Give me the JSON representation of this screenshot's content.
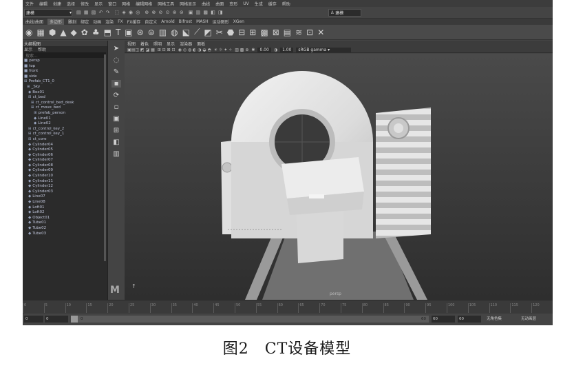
{
  "app": {
    "menus": [
      "文件",
      "编辑",
      "创建",
      "选择",
      "修改",
      "显示",
      "窗口",
      "网格",
      "编辑网格",
      "网格工具",
      "网格显示",
      "曲线",
      "曲面",
      "变形",
      "UV",
      "生成",
      "缓存",
      "帮助"
    ],
    "mode_selector": "建模",
    "workspace_selector": "建模"
  },
  "shelf": {
    "tabs": [
      "曲线/曲面",
      "多边形",
      "雕刻",
      "绑定",
      "动画",
      "渲染",
      "FX",
      "FX缓存",
      "自定义",
      "Arnold",
      "Bifrost",
      "MASH",
      "运动图形",
      "XGen"
    ],
    "active_tab_index": 1
  },
  "outliner": {
    "title": "大纲视图",
    "menus": [
      "显示",
      "帮助"
    ],
    "search_placeholder": "搜索...",
    "items": [
      {
        "icon": "camera-icon",
        "label": "persp"
      },
      {
        "icon": "camera-icon",
        "label": "top"
      },
      {
        "icon": "camera-icon",
        "label": "front"
      },
      {
        "icon": "camera-icon",
        "label": "side"
      },
      {
        "icon": "group-icon",
        "label": "Prefab_CT1_0"
      },
      {
        "icon": "group-icon",
        "label": "_Sky"
      },
      {
        "icon": "mesh-icon",
        "label": "Box01"
      },
      {
        "icon": "group-icon",
        "label": "ct_bed"
      },
      {
        "icon": "group-icon",
        "label": "ct_control_bed_desk"
      },
      {
        "icon": "group-icon",
        "label": "ct_move_bed"
      },
      {
        "icon": "group-icon",
        "label": "prefab_person"
      },
      {
        "icon": "mesh-icon",
        "label": "Line01"
      },
      {
        "icon": "mesh-icon",
        "label": "Line02"
      },
      {
        "icon": "group-icon",
        "label": "ct_control_key_2"
      },
      {
        "icon": "group-icon",
        "label": "ct_control_key_1"
      },
      {
        "icon": "group-icon",
        "label": "ct_core"
      },
      {
        "icon": "mesh-icon",
        "label": "Cylinder04"
      },
      {
        "icon": "mesh-icon",
        "label": "Cylinder05"
      },
      {
        "icon": "mesh-icon",
        "label": "Cylinder06"
      },
      {
        "icon": "mesh-icon",
        "label": "Cylinder07"
      },
      {
        "icon": "mesh-icon",
        "label": "Cylinder08"
      },
      {
        "icon": "mesh-icon",
        "label": "Cylinder09"
      },
      {
        "icon": "mesh-icon",
        "label": "Cylinder10"
      },
      {
        "icon": "mesh-icon",
        "label": "Cylinder11"
      },
      {
        "icon": "mesh-icon",
        "label": "Cylinder12"
      },
      {
        "icon": "mesh-icon",
        "label": "Cylinder03"
      },
      {
        "icon": "mesh-icon",
        "label": "Line07"
      },
      {
        "icon": "mesh-icon",
        "label": "Line08"
      },
      {
        "icon": "mesh-icon",
        "label": "Loft01"
      },
      {
        "icon": "mesh-icon",
        "label": "Loft02"
      },
      {
        "icon": "mesh-icon",
        "label": "Object01"
      },
      {
        "icon": "mesh-icon",
        "label": "Tube01"
      },
      {
        "icon": "mesh-icon",
        "label": "Tube02"
      },
      {
        "icon": "mesh-icon",
        "label": "Tube03"
      }
    ]
  },
  "viewport": {
    "menus": [
      "视图",
      "着色",
      "照明",
      "显示",
      "渲染器",
      "面板"
    ],
    "exposure": "0.00",
    "gamma": "1.00",
    "color_space": "sRGB gamma",
    "camera_label": "persp"
  },
  "timeline": {
    "ticks": [
      "0",
      "5",
      "10",
      "15",
      "20",
      "25",
      "30",
      "35",
      "40",
      "45",
      "50",
      "55",
      "60",
      "65",
      "70",
      "75",
      "80",
      "85",
      "90",
      "95",
      "100",
      "105",
      "110",
      "115",
      "120"
    ],
    "start_field": "0",
    "playback_start": "0",
    "range_start_label": "0",
    "range_end_label": "60",
    "end_field": "60",
    "anim_end": "60",
    "character_set": "无角色集",
    "anim_layer": "无动画层"
  },
  "caption": "图2　CT设备模型",
  "colors": {
    "panel_bg": "#444444",
    "outliner_bg": "#2b2b2b",
    "viewport_top": "#454545",
    "viewport_bottom": "#2f2f2f"
  }
}
